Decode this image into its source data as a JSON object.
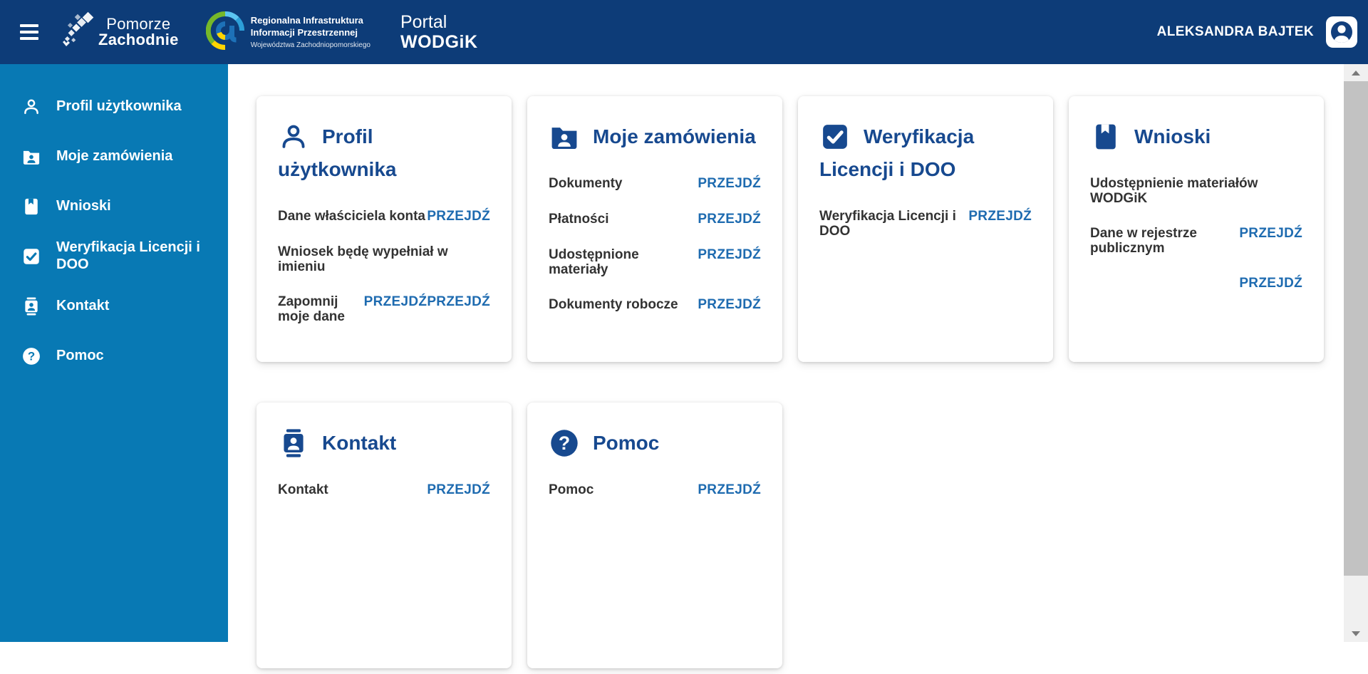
{
  "header": {
    "pz_logo": {
      "line1": "Pomorze",
      "line2": "Zachodnie"
    },
    "riip_logo": {
      "line1": "Regionalna Infrastruktura",
      "line2": "Informacji Przestrzennej",
      "line3": "Województwa Zachodniopomorskiego"
    },
    "portal": {
      "line1": "Portal",
      "line2": "WODGiK"
    },
    "user_name": "ALEKSANDRA BAJTEK"
  },
  "sidebar": {
    "items": [
      {
        "label": "Profil użytkownika",
        "icon": "person-icon"
      },
      {
        "label": "Moje zamówienia",
        "icon": "folder-user-icon"
      },
      {
        "label": "Wnioski",
        "icon": "book-icon"
      },
      {
        "label": "Weryfikacja Licencji i DOO",
        "icon": "checkbox-checked-icon"
      },
      {
        "label": "Kontakt",
        "icon": "contact-card-icon"
      },
      {
        "label": "Pomoc",
        "icon": "help-icon"
      }
    ]
  },
  "cards": [
    {
      "title": "Profil użytkownika",
      "icon": "person-icon",
      "rows": [
        {
          "label": "Dane właściciela konta",
          "links": [
            "PRZEJDŹ"
          ]
        },
        {
          "label": "Wniosek będę wypełniał w imieniu",
          "links": []
        },
        {
          "label": "Zapomnij moje dane",
          "links": [
            "PRZEJDŹ",
            "PRZEJDŹ"
          ]
        }
      ]
    },
    {
      "title": "Moje zamówienia",
      "icon": "folder-user-icon",
      "rows": [
        {
          "label": "Dokumenty",
          "links": [
            "PRZEJDŹ"
          ]
        },
        {
          "label": "Płatności",
          "links": [
            "PRZEJDŹ"
          ]
        },
        {
          "label": "Udostępnione materiały",
          "links": [
            "PRZEJDŹ"
          ]
        },
        {
          "label": "Dokumenty robocze",
          "links": [
            "PRZEJDŹ"
          ]
        }
      ]
    },
    {
      "title": "Weryfikacja Licencji i DOO",
      "icon": "checkbox-checked-icon",
      "rows": [
        {
          "label": "Weryfikacja Licencji i DOO",
          "links": [
            "PRZEJDŹ"
          ]
        }
      ]
    },
    {
      "title": "Wnioski",
      "icon": "book-icon",
      "rows": [
        {
          "label": "Udostępnienie materiałów WODGiK",
          "links": []
        },
        {
          "label": "Dane w rejestrze publicznym",
          "links": [
            "PRZEJDŹ"
          ]
        },
        {
          "label": "",
          "links": [
            "PRZEJDŹ"
          ]
        }
      ]
    },
    {
      "title": "Kontakt",
      "icon": "contact-card-icon",
      "rows": [
        {
          "label": "Kontakt",
          "links": [
            "PRZEJDŹ"
          ]
        }
      ]
    },
    {
      "title": "Pomoc",
      "icon": "help-icon",
      "rows": [
        {
          "label": "Pomoc",
          "links": [
            "PRZEJDŹ"
          ]
        }
      ]
    }
  ],
  "colors": {
    "header_bg": "#0d3c78",
    "sidebar_bg": "#0879b4",
    "card_title": "#17498f",
    "link_blue": "#1e6bb0",
    "row_label": "#333333"
  }
}
